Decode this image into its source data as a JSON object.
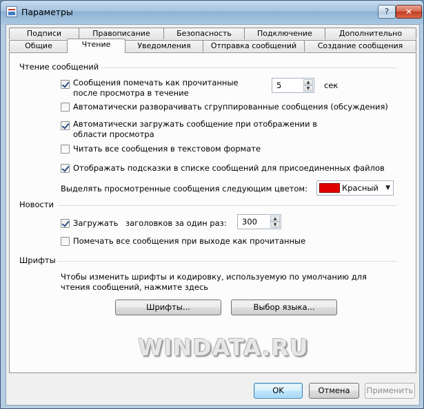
{
  "window": {
    "title": "Параметры",
    "help_label": "?",
    "close_label": "✕"
  },
  "tabs": {
    "row1": [
      "Подписи",
      "Правописание",
      "Безопасность",
      "Подключение",
      "Дополнительно"
    ],
    "row2": [
      "Общие",
      "Чтение",
      "Уведомления",
      "Отправка сообщений",
      "Создание сообщения"
    ],
    "active": "Чтение"
  },
  "reading": {
    "title": "Чтение сообщений",
    "mark_read": {
      "label": "Сообщения помечать как прочитанные после просмотра в течение",
      "checked": true
    },
    "mark_read_seconds": "5",
    "seconds_unit": "сек",
    "expand_groups": {
      "label": "Автоматически разворачивать сгруппированные сообщения (обсуждения)",
      "checked": false
    },
    "auto_download": {
      "label": "Автоматически загружать сообщение при отображении в области просмотра",
      "checked": true
    },
    "plain_text": {
      "label": "Читать все сообщения в текстовом формате",
      "checked": false
    },
    "tooltips": {
      "label": "Отображать подсказки в списке сообщений для присоединенных файлов",
      "checked": true
    },
    "highlight_label": "Выделять просмотренные сообщения следующим цветом:",
    "highlight_color": {
      "name": "Красный",
      "hex": "#e00000"
    }
  },
  "news": {
    "title": "Новости",
    "download": {
      "label": "Загружать",
      "checked": true
    },
    "headers_label": "заголовков за один раз:",
    "headers_count": "300",
    "mark_all_read": {
      "label": "Помечать все сообщения при выходе как прочитанные",
      "checked": false
    }
  },
  "fonts": {
    "title": "Шрифты",
    "description": "Чтобы изменить шрифты и кодировку, используемую по умолчанию для чтения сообщений, нажмите здесь",
    "fonts_button": "Шрифты...",
    "language_button": "Выбор языка..."
  },
  "watermark": "WINDATA.RU",
  "footer": {
    "ok": "OK",
    "cancel": "Отмена",
    "apply": "Применить"
  }
}
